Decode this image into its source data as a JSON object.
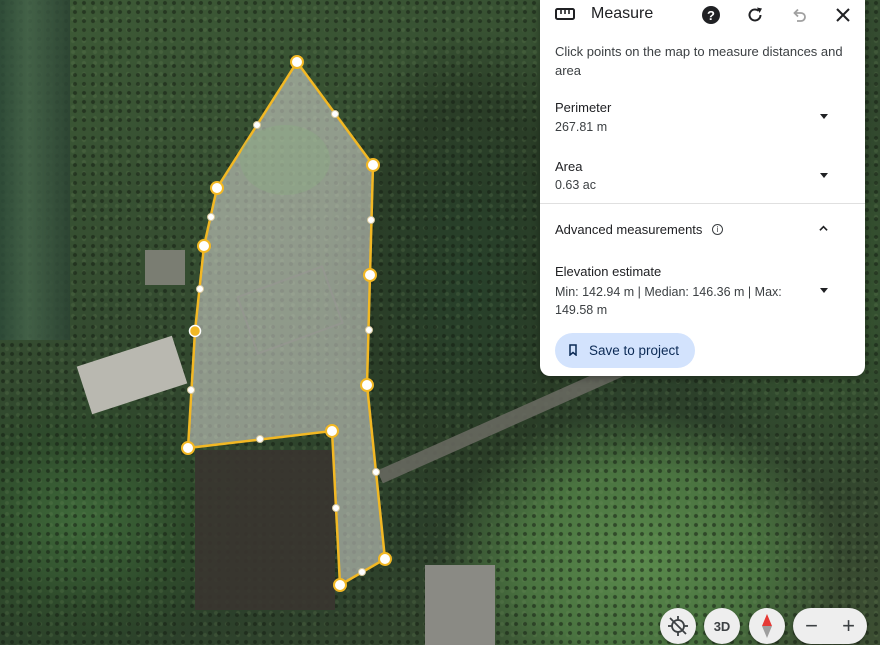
{
  "panel": {
    "title": "Measure",
    "help_icon": "help-icon",
    "refresh_icon": "refresh-icon",
    "undo_icon": "undo-icon",
    "close_icon": "close-icon",
    "instructions": "Click points on the map to measure distances and area",
    "perimeter": {
      "label": "Perimeter",
      "value": "267.81 m"
    },
    "area": {
      "label": "Area",
      "value": "0.63 ac"
    },
    "advanced": {
      "label": "Advanced measurements"
    },
    "elevation": {
      "label": "Elevation estimate",
      "value": "Min: 142.94 m | Median: 146.36 m | Max: 149.58 m"
    },
    "save_label": "Save to project"
  },
  "map_controls": {
    "threed_label": "3D",
    "zoom_out_label": "−",
    "zoom_in_label": "+"
  },
  "colors": {
    "polygon_stroke": "#f2b824",
    "polygon_fill": "rgba(255,255,255,0.38)",
    "save_button_bg": "#d3e3fd",
    "compass_red": "#e53935"
  }
}
